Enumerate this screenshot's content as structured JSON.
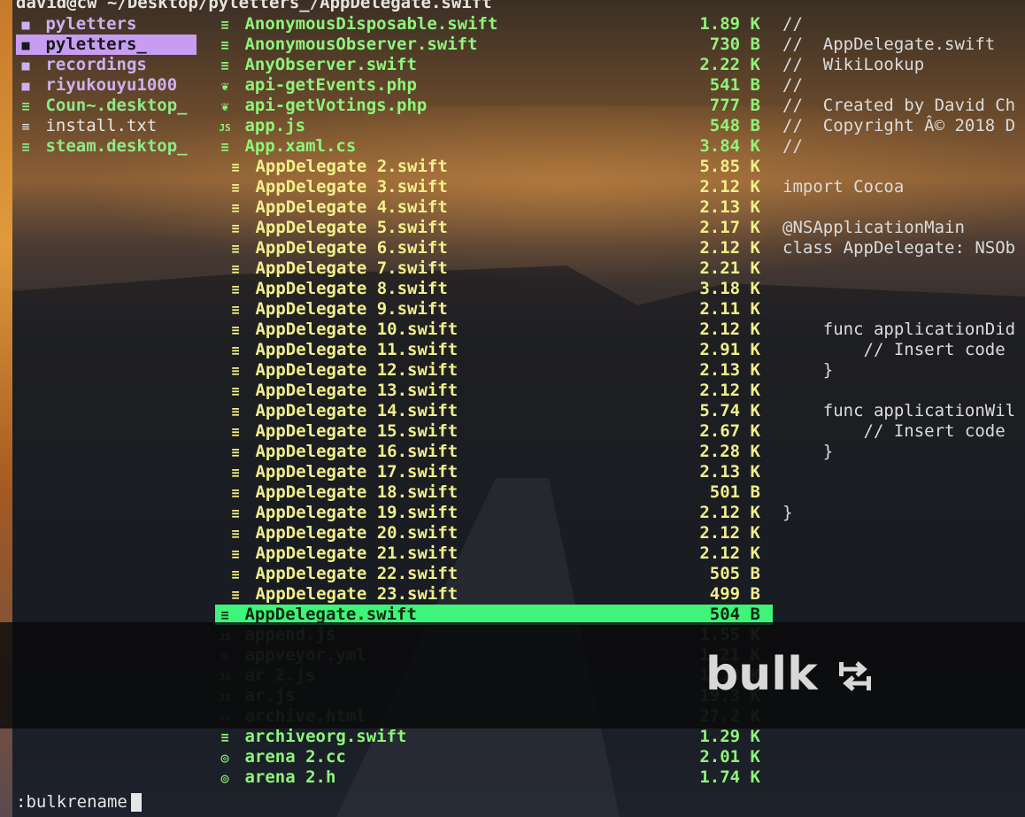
{
  "title": "david@cw ~/Desktop/pyletters_/AppDelegate.swift",
  "parent_items": [
    {
      "icon": "folder-icon",
      "name": "pyletters",
      "kind": "dir"
    },
    {
      "icon": "folder-icon",
      "name": "pyletters_",
      "kind": "dir",
      "selected": true
    },
    {
      "icon": "folder-icon",
      "name": "recordings",
      "kind": "dir"
    },
    {
      "icon": "folder-icon",
      "name": "riyukouyu1000",
      "kind": "dir"
    },
    {
      "icon": "file-icon",
      "name": "Coun~.desktop_",
      "kind": "file"
    },
    {
      "icon": "file-icon",
      "name": "install.txt",
      "kind": "plain"
    },
    {
      "icon": "file-icon",
      "name": "steam.desktop_",
      "kind": "file"
    }
  ],
  "files": [
    {
      "icon": "≡",
      "name": "AnonymousDisposable.swift",
      "size": "1.89 K"
    },
    {
      "icon": "≡",
      "name": "AnonymousObserver.swift",
      "size": "730 B"
    },
    {
      "icon": "≡",
      "name": "AnyObserver.swift",
      "size": "2.22 K"
    },
    {
      "icon": "❦",
      "name": "api-getEvents.php",
      "size": "541 B"
    },
    {
      "icon": "❦",
      "name": "api-getVotings.php",
      "size": "777 B"
    },
    {
      "icon": "JS",
      "name": "app.js",
      "size": "548 B"
    },
    {
      "icon": "≡",
      "name": "App.xaml.cs",
      "size": "3.84 K"
    },
    {
      "icon": "≡",
      "name": "AppDelegate 2.swift",
      "size": "5.85 K",
      "sub": true
    },
    {
      "icon": "≡",
      "name": "AppDelegate 3.swift",
      "size": "2.12 K",
      "sub": true
    },
    {
      "icon": "≡",
      "name": "AppDelegate 4.swift",
      "size": "2.13 K",
      "sub": true
    },
    {
      "icon": "≡",
      "name": "AppDelegate 5.swift",
      "size": "2.17 K",
      "sub": true
    },
    {
      "icon": "≡",
      "name": "AppDelegate 6.swift",
      "size": "2.12 K",
      "sub": true
    },
    {
      "icon": "≡",
      "name": "AppDelegate 7.swift",
      "size": "2.21 K",
      "sub": true
    },
    {
      "icon": "≡",
      "name": "AppDelegate 8.swift",
      "size": "3.18 K",
      "sub": true
    },
    {
      "icon": "≡",
      "name": "AppDelegate 9.swift",
      "size": "2.11 K",
      "sub": true
    },
    {
      "icon": "≡",
      "name": "AppDelegate 10.swift",
      "size": "2.12 K",
      "sub": true
    },
    {
      "icon": "≡",
      "name": "AppDelegate 11.swift",
      "size": "2.91 K",
      "sub": true
    },
    {
      "icon": "≡",
      "name": "AppDelegate 12.swift",
      "size": "2.13 K",
      "sub": true
    },
    {
      "icon": "≡",
      "name": "AppDelegate 13.swift",
      "size": "2.12 K",
      "sub": true
    },
    {
      "icon": "≡",
      "name": "AppDelegate 14.swift",
      "size": "5.74 K",
      "sub": true
    },
    {
      "icon": "≡",
      "name": "AppDelegate 15.swift",
      "size": "2.67 K",
      "sub": true
    },
    {
      "icon": "≡",
      "name": "AppDelegate 16.swift",
      "size": "2.28 K",
      "sub": true
    },
    {
      "icon": "≡",
      "name": "AppDelegate 17.swift",
      "size": "2.13 K",
      "sub": true
    },
    {
      "icon": "≡",
      "name": "AppDelegate 18.swift",
      "size": "501 B",
      "sub": true
    },
    {
      "icon": "≡",
      "name": "AppDelegate 19.swift",
      "size": "2.12 K",
      "sub": true
    },
    {
      "icon": "≡",
      "name": "AppDelegate 20.swift",
      "size": "2.12 K",
      "sub": true
    },
    {
      "icon": "≡",
      "name": "AppDelegate 21.swift",
      "size": "2.12 K",
      "sub": true
    },
    {
      "icon": "≡",
      "name": "AppDelegate 22.swift",
      "size": "505 B",
      "sub": true
    },
    {
      "icon": "≡",
      "name": "AppDelegate 23.swift",
      "size": "499 B",
      "sub": true
    },
    {
      "icon": "≡",
      "name": "AppDelegate.swift",
      "size": "504 B",
      "active": true
    },
    {
      "icon": "JS",
      "name": "append.js",
      "size": "1.55 K",
      "dim": true
    },
    {
      "icon": "⚙",
      "name": "appveyor.yml",
      "size": "1.21 K",
      "dim": true
    },
    {
      "icon": "JS",
      "name": "ar 2.js",
      "size": "19.3 K",
      "dim": true
    },
    {
      "icon": "JS",
      "name": "ar.js",
      "size": "19.3 K",
      "dim": true
    },
    {
      "icon": "<>",
      "name": "archive.html",
      "size": "27.2 K",
      "dim": true
    },
    {
      "icon": "≡",
      "name": "archiveorg.swift",
      "size": "1.29 K"
    },
    {
      "icon": "◎",
      "name": "arena 2.cc",
      "size": "2.01 K"
    },
    {
      "icon": "◎",
      "name": "arena 2.h",
      "size": "1.74 K"
    }
  ],
  "preview_lines": [
    "//",
    "//  AppDelegate.swift",
    "//  WikiLookup",
    "//",
    "//  Created by David Ch",
    "//  Copyright Â© 2018 D",
    "//",
    "",
    "import Cocoa",
    "",
    "@NSApplicationMain",
    "class AppDelegate: NSOb",
    "",
    "",
    "",
    "    func applicationDid",
    "        // Insert code",
    "    }",
    "",
    "    func applicationWil",
    "        // Insert code",
    "    }",
    "",
    "",
    "}"
  ],
  "overlay": {
    "logo_text": "bulk",
    "logo_icon": "swap-arrows-icon"
  },
  "command": ":bulkrename"
}
